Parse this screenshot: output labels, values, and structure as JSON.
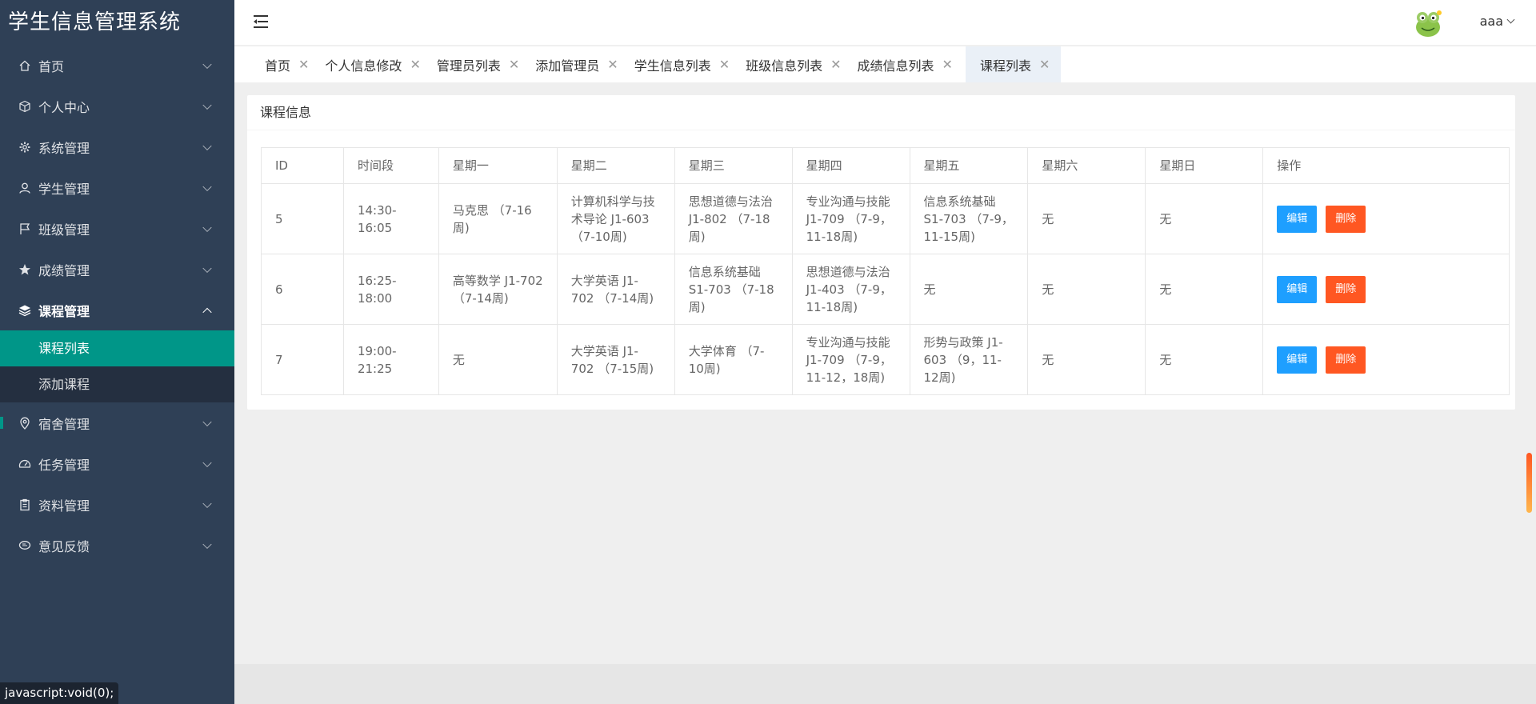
{
  "app": {
    "title": "学生信息管理系统"
  },
  "sidebar": {
    "items": [
      {
        "label": "首页",
        "icon": "home-icon"
      },
      {
        "label": "个人中心",
        "icon": "cube-icon"
      },
      {
        "label": "系统管理",
        "icon": "gear-icon"
      },
      {
        "label": "学生管理",
        "icon": "user-icon"
      },
      {
        "label": "班级管理",
        "icon": "flag-icon"
      },
      {
        "label": "成绩管理",
        "icon": "star-icon"
      },
      {
        "label": "课程管理",
        "icon": "layers-icon",
        "expanded": true,
        "children": [
          {
            "label": "课程列表",
            "active": true
          },
          {
            "label": "添加课程"
          }
        ]
      },
      {
        "label": "宿舍管理",
        "icon": "location-icon"
      },
      {
        "label": "任务管理",
        "icon": "gauge-icon"
      },
      {
        "label": "资料管理",
        "icon": "clipboard-icon"
      },
      {
        "label": "意见反馈",
        "icon": "chat-icon"
      }
    ]
  },
  "header": {
    "user": "aaa"
  },
  "tabs": [
    {
      "label": "首页"
    },
    {
      "label": "个人信息修改"
    },
    {
      "label": "管理员列表"
    },
    {
      "label": "添加管理员"
    },
    {
      "label": "学生信息列表"
    },
    {
      "label": "班级信息列表"
    },
    {
      "label": "成绩信息列表"
    },
    {
      "label": "课程列表",
      "active": true
    }
  ],
  "card": {
    "title": "课程信息"
  },
  "table": {
    "headers": [
      "ID",
      "时间段",
      "星期一",
      "星期二",
      "星期三",
      "星期四",
      "星期五",
      "星期六",
      "星期日",
      "操作"
    ],
    "rows": [
      [
        "5",
        "14:30-16:05",
        "马克思 （7-16周)",
        "计算机科学与技术导论 J1-603 （7-10周)",
        "思想道德与法治 J1-802 （7-18周)",
        "专业沟通与技能 J1-709 （7-9，11-18周)",
        "信息系统基础 S1-703 （7-9，11-15周)",
        "无",
        "无"
      ],
      [
        "6",
        "16:25-18:00",
        "高等数学 J1-702 （7-14周)",
        "大学英语 J1-702 （7-14周)",
        "信息系统基础 S1-703 （7-18周)",
        "思想道德与法治 J1-403 （7-9，11-18周)",
        "无",
        "无",
        "无"
      ],
      [
        "7",
        "19:00-21:25",
        "无",
        "大学英语 J1-702 （7-15周)",
        "大学体育 （7-10周)",
        "专业沟通与技能 J1-709 （7-9，11-12，18周)",
        "形势与政策 J1-603 （9，11-12周)",
        "无",
        "无"
      ]
    ],
    "edit_label": "编辑",
    "delete_label": "删除"
  },
  "status_bar": {
    "url": "javascript:void(0);"
  },
  "colors": {
    "sidebar": "#2f4056",
    "accent": "#009688",
    "edit": "#1e9fff",
    "delete": "#ff5722"
  }
}
